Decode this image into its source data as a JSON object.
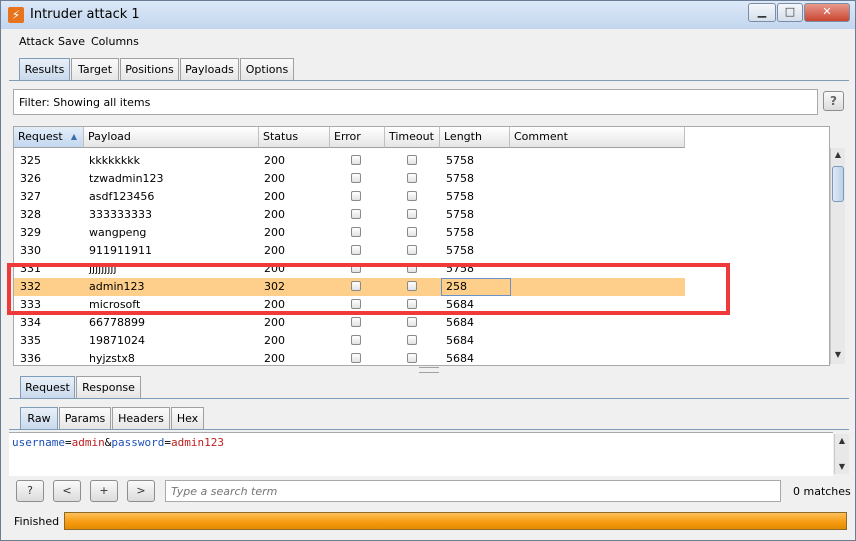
{
  "window": {
    "title": "Intruder attack 1"
  },
  "menu": [
    "Attack",
    "Save",
    "Columns"
  ],
  "tabs": {
    "main": [
      "Results",
      "Target",
      "Positions",
      "Payloads",
      "Options"
    ],
    "main_active": "Results",
    "message": [
      "Request",
      "Response"
    ],
    "message_active": "Request",
    "view": [
      "Raw",
      "Params",
      "Headers",
      "Hex"
    ],
    "view_active": "Raw"
  },
  "filter": {
    "text": "Filter:  Showing all items"
  },
  "help_label": "?",
  "table": {
    "columns": [
      "Request",
      "Payload",
      "Status",
      "Error",
      "Timeout",
      "Length",
      "Comment"
    ],
    "sorted_column": "Request",
    "rows": [
      {
        "request": "325",
        "payload": "kkkkkkkk",
        "status": "200",
        "error": false,
        "timeout": false,
        "length": "5758",
        "comment": ""
      },
      {
        "request": "326",
        "payload": "tzwadmin123",
        "status": "200",
        "error": false,
        "timeout": false,
        "length": "5758",
        "comment": ""
      },
      {
        "request": "327",
        "payload": "asdf123456",
        "status": "200",
        "error": false,
        "timeout": false,
        "length": "5758",
        "comment": ""
      },
      {
        "request": "328",
        "payload": "333333333",
        "status": "200",
        "error": false,
        "timeout": false,
        "length": "5758",
        "comment": ""
      },
      {
        "request": "329",
        "payload": "wangpeng",
        "status": "200",
        "error": false,
        "timeout": false,
        "length": "5758",
        "comment": ""
      },
      {
        "request": "330",
        "payload": "911911911",
        "status": "200",
        "error": false,
        "timeout": false,
        "length": "5758",
        "comment": ""
      },
      {
        "request": "331",
        "payload": "jjjjjjjjj",
        "status": "200",
        "error": false,
        "timeout": false,
        "length": "5758",
        "comment": ""
      },
      {
        "request": "332",
        "payload": "admin123",
        "status": "302",
        "error": false,
        "timeout": false,
        "length": "258",
        "comment": "",
        "selected": true
      },
      {
        "request": "333",
        "payload": "microsoft",
        "status": "200",
        "error": false,
        "timeout": false,
        "length": "5684",
        "comment": ""
      },
      {
        "request": "334",
        "payload": "66778899",
        "status": "200",
        "error": false,
        "timeout": false,
        "length": "5684",
        "comment": ""
      },
      {
        "request": "335",
        "payload": "19871024",
        "status": "200",
        "error": false,
        "timeout": false,
        "length": "5684",
        "comment": ""
      },
      {
        "request": "336",
        "payload": "hyjzstx8",
        "status": "200",
        "error": false,
        "timeout": false,
        "length": "5684",
        "comment": ""
      }
    ]
  },
  "request_body": {
    "k1": "username",
    "eq1": "=",
    "v1": "admin",
    "amp": "&",
    "k2": "password",
    "eq2": "=",
    "v2": "admin123"
  },
  "search": {
    "buttons": [
      "?",
      "<",
      "+",
      ">"
    ],
    "placeholder": "Type a search term",
    "matches": "0 matches"
  },
  "status": {
    "text": "Finished",
    "progress": 1.0
  },
  "colors": {
    "highlight": "#fdcf8a",
    "annotation": "#ee3a3a",
    "progress": "#f59a0e"
  }
}
